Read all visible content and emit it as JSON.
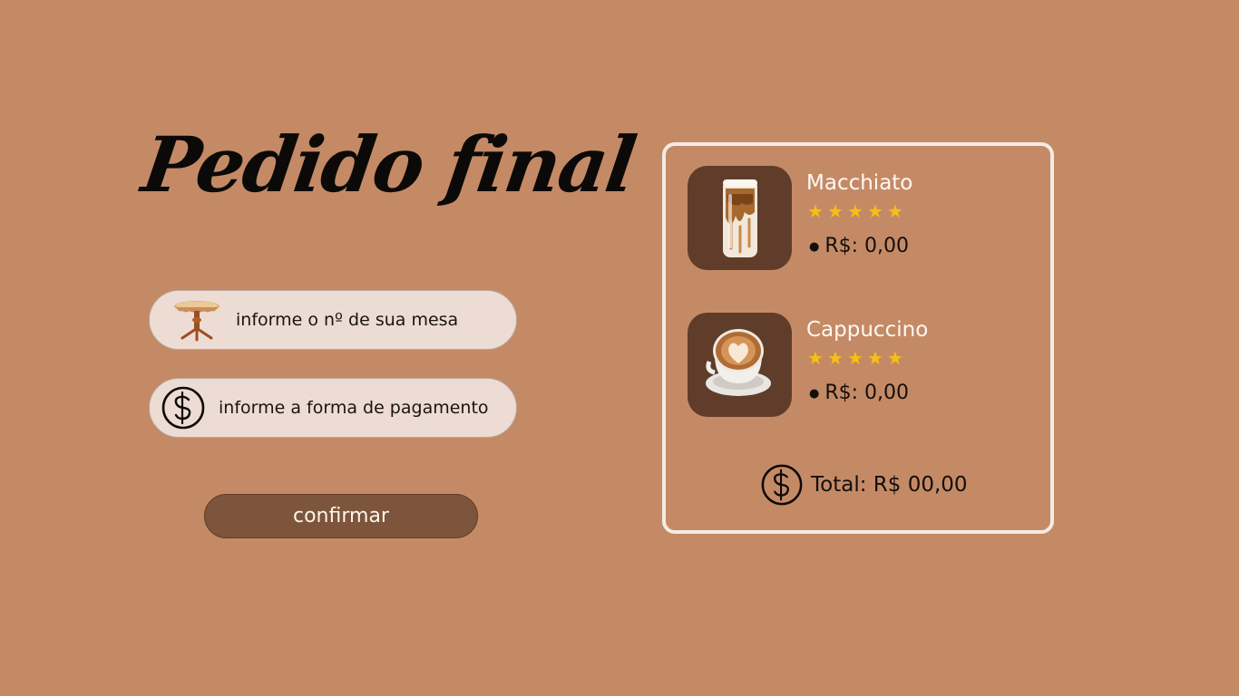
{
  "page": {
    "title": "Pedido final",
    "background": "#c48a66"
  },
  "form": {
    "table_placeholder": "informe o nº de sua mesa",
    "payment_placeholder": "informe a forma de pagamento",
    "confirm_label": "confirmar",
    "table_icon": "table-icon",
    "payment_icon": "dollar-coin-icon"
  },
  "order": {
    "items": [
      {
        "name": "Macchiato",
        "rating": 5,
        "max_rating": 5,
        "price": "R$: 0,00",
        "image": "iced-macchiato-icon"
      },
      {
        "name": "Cappuccino",
        "rating": 5,
        "max_rating": 5,
        "price": "R$: 0,00",
        "image": "cappuccino-cup-icon"
      }
    ],
    "total_label": "Total: R$ 00,00"
  },
  "colors": {
    "pill_bg": "#eddcd3",
    "button_bg": "#7c553c",
    "thumb_bg": "#5f3d2a",
    "star": "#f7bf13",
    "panel_border": "#f4ebe4"
  }
}
